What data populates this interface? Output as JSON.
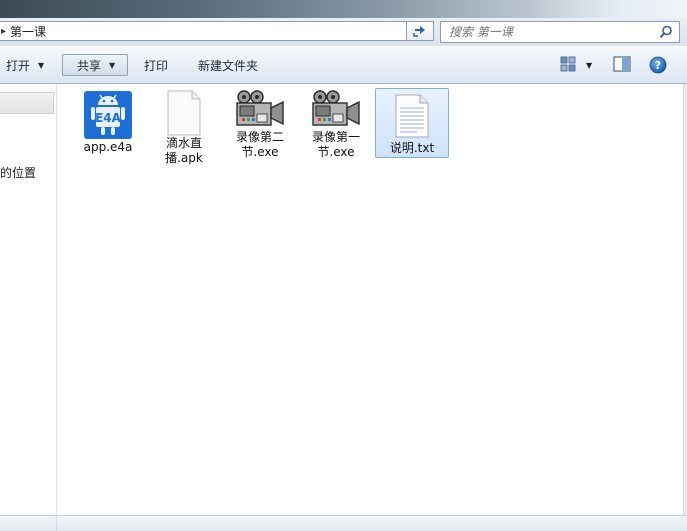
{
  "address": {
    "crumbs": [
      "第一课"
    ],
    "separator": "▸"
  },
  "search": {
    "placeholder": "搜索 第一课"
  },
  "toolbar": {
    "open_label": "打开",
    "share_label": "共享",
    "print_label": "打印",
    "new_folder_label": "新建文件夹"
  },
  "nav": {
    "recent_label": "的位置"
  },
  "files": [
    {
      "name": "app.e4a",
      "icon": "e4a-app-icon",
      "selected": false
    },
    {
      "name": "滴水直播.apk",
      "icon": "blank-file-icon",
      "selected": false
    },
    {
      "name": "录像第二节.exe",
      "icon": "video-camera-icon",
      "selected": false
    },
    {
      "name": "录像第一节.exe",
      "icon": "video-camera-icon",
      "selected": false
    },
    {
      "name": "说明.txt",
      "icon": "text-file-icon",
      "selected": true
    }
  ],
  "colors": {
    "accent": "#2f62a8",
    "selection": "#cfe3fb",
    "e4a_blue": "#1d6fd6"
  }
}
